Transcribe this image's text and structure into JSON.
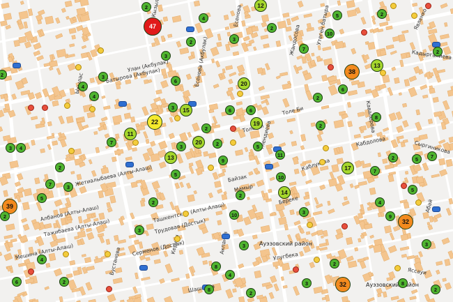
{
  "map": {
    "colors": {
      "background": "#f2f1ef",
      "road": "#ffffff",
      "building": "#f4c58e",
      "building_edge": "#e0a866",
      "marker_green": "#4fb52f",
      "marker_lime": "#a6d72c",
      "marker_yellow": "#f5ea2d",
      "marker_orange": "#f38a1e",
      "marker_red": "#e11a1a"
    },
    "districts": [
      "Ауэзовский район",
      "Ауэзовский район"
    ],
    "streets": [
      "Улан (Акбулак)",
      "Батырова (Акбулак)",
      "Есенова (Акбулак)",
      "Есенова",
      "Толе Би",
      "Толе Би",
      "Каблукова",
      "Кабдолова",
      "Сыргиникова",
      "Жандосова",
      "Тлендиева",
      "Утеген батыра",
      "Мамыр",
      "Улугбека",
      "Абай",
      "Яссауи",
      "Явленко",
      "Кавалерова",
      "Кадыргалиева",
      "Серменов (Достык)",
      "Трудовая (Достык)",
      "Ташкентская (Алты-Алаш)",
      "Жетиалыбаева (Алты-Алаш)",
      "Мешина (Алты-Алаш)",
      "Тажибаева (Алты-Алаш)",
      "Албанов (Алты-Алаш)",
      "Керуен",
      "Байзак",
      "Шашкина",
      "Береке",
      "Бустанова",
      "Акпанов",
      "Кызыл",
      "Ыкылас"
    ],
    "markers": [
      {
        "count": "47",
        "level": "red"
      },
      {
        "count": "38",
        "level": "orange"
      },
      {
        "count": "39",
        "level": "orange"
      },
      {
        "count": "32",
        "level": "orange"
      },
      {
        "count": "32",
        "level": "orange"
      },
      {
        "count": "22",
        "level": "yellow"
      },
      {
        "count": "20",
        "level": "lime"
      },
      {
        "count": "20",
        "level": "lime"
      },
      {
        "count": "15",
        "level": "lime"
      },
      {
        "count": "19",
        "level": "lime"
      },
      {
        "count": "17",
        "level": "lime"
      },
      {
        "count": "14",
        "level": "lime"
      },
      {
        "count": "13",
        "level": "lime"
      },
      {
        "count": "13",
        "level": "lime"
      },
      {
        "count": "11",
        "level": "lime"
      },
      {
        "count": "12",
        "level": "lime"
      },
      {
        "count": "10",
        "level": "green"
      },
      {
        "count": "10",
        "level": "green"
      },
      {
        "count": "10",
        "level": "green"
      },
      {
        "count": "11",
        "level": "green"
      },
      {
        "count": "3",
        "level": "green"
      },
      {
        "count": "4",
        "level": "green"
      },
      {
        "count": "2",
        "level": "green"
      },
      {
        "count": "4",
        "level": "green"
      },
      {
        "count": "6",
        "level": "green"
      },
      {
        "count": "2",
        "level": "green"
      },
      {
        "count": "7",
        "level": "green"
      },
      {
        "count": "5",
        "level": "green"
      },
      {
        "count": "2",
        "level": "green"
      },
      {
        "count": "3",
        "level": "green"
      },
      {
        "count": "6",
        "level": "green"
      },
      {
        "count": "8",
        "level": "green"
      },
      {
        "count": "9",
        "level": "green"
      },
      {
        "count": "2",
        "level": "green"
      },
      {
        "count": "4",
        "level": "green"
      },
      {
        "count": "7",
        "level": "green"
      },
      {
        "count": "5",
        "level": "green"
      },
      {
        "count": "2",
        "level": "green"
      },
      {
        "count": "6",
        "level": "green"
      },
      {
        "count": "3",
        "level": "green"
      },
      {
        "count": "2",
        "level": "green"
      },
      {
        "count": "4",
        "level": "green"
      },
      {
        "count": "8",
        "level": "green"
      },
      {
        "count": "3",
        "level": "green"
      },
      {
        "count": "2",
        "level": "green"
      },
      {
        "count": "5",
        "level": "green"
      },
      {
        "count": "2",
        "level": "green"
      },
      {
        "count": "7",
        "level": "green"
      },
      {
        "count": "3",
        "level": "green"
      },
      {
        "count": "2",
        "level": "green"
      },
      {
        "count": "4",
        "level": "green"
      },
      {
        "count": "2",
        "level": "green"
      },
      {
        "count": "6",
        "level": "green"
      },
      {
        "count": "3",
        "level": "green"
      },
      {
        "count": "2",
        "level": "green"
      },
      {
        "count": "8",
        "level": "green"
      },
      {
        "count": "5",
        "level": "green"
      },
      {
        "count": "2",
        "level": "green"
      },
      {
        "count": "7",
        "level": "green"
      },
      {
        "count": "3",
        "level": "green"
      },
      {
        "count": "4",
        "level": "green"
      },
      {
        "count": "2",
        "level": "green"
      },
      {
        "count": "9",
        "level": "green"
      },
      {
        "count": "3",
        "level": "green"
      },
      {
        "count": "2",
        "level": "green"
      },
      {
        "count": "6",
        "level": "green"
      },
      {
        "count": "2",
        "level": "green"
      },
      {
        "count": "5",
        "level": "green"
      },
      {
        "count": "3",
        "level": "green"
      },
      {
        "count": "2",
        "level": "green"
      },
      {
        "count": "4",
        "level": "green"
      },
      {
        "count": "3",
        "level": "green"
      },
      {
        "count": "2",
        "level": "green"
      },
      {
        "count": "7",
        "level": "green"
      },
      {
        "count": "2",
        "level": "green"
      },
      {
        "count": "3",
        "level": "green"
      },
      {
        "count": "5",
        "level": "green"
      },
      {
        "count": "2",
        "level": "green"
      },
      {
        "count": "8",
        "level": "green"
      },
      {
        "count": "3",
        "level": "green"
      }
    ],
    "poi_icons": [
      "traffic-light-icon",
      "car-icon",
      "accident-icon",
      "warning-icon"
    ]
  }
}
